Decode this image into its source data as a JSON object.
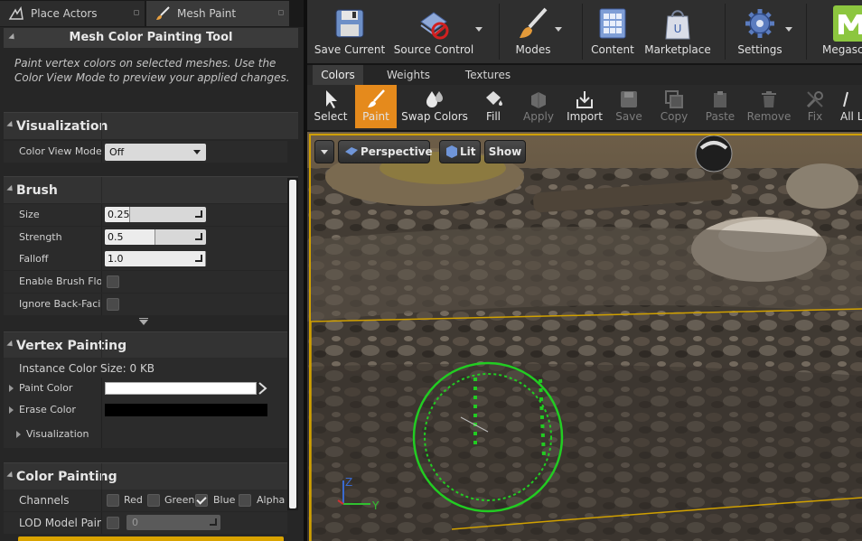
{
  "left_tabs": [
    {
      "label": "Place Actors"
    },
    {
      "label": "Mesh Paint"
    }
  ],
  "tool": {
    "title": "Mesh Color Painting Tool",
    "description": "Paint vertex colors on selected meshes.  Use the Color View Mode to preview your applied changes."
  },
  "visualization": {
    "header": "Visualization",
    "color_view_mode_label": "Color View Mode",
    "color_view_mode_value": "Off"
  },
  "brush": {
    "header": "Brush",
    "size_label": "Size",
    "size_value": "0.25",
    "size_fraction": 0.25,
    "strength_label": "Strength",
    "strength_value": "0.5",
    "strength_fraction": 0.5,
    "falloff_label": "Falloff",
    "falloff_value": "1.0",
    "falloff_fraction": 1.0,
    "enable_flow_label": "Enable Brush Flow",
    "ignore_backfacing_label": "Ignore Back-Facing"
  },
  "vertex_painting": {
    "header": "Vertex Painting",
    "instance_color_size": "Instance Color Size: 0 KB",
    "paint_color_label": "Paint Color",
    "paint_color": "#ffffff",
    "erase_color_label": "Erase Color",
    "erase_color": "#000000",
    "visualization_label": "Visualization"
  },
  "color_painting": {
    "header": "Color Painting",
    "channels_label": "Channels",
    "channels": [
      {
        "label": "Red",
        "checked": false
      },
      {
        "label": "Green",
        "checked": false
      },
      {
        "label": "Blue",
        "checked": true
      },
      {
        "label": "Alpha",
        "checked": false
      }
    ],
    "lod_label": "LOD Model Painting",
    "lod_value": "0"
  },
  "toolbar": {
    "items": [
      {
        "label": "Save Current",
        "icon": "floppy-disk-icon"
      },
      {
        "label": "Source Control",
        "icon": "source-control-icon"
      },
      {
        "label": "Modes",
        "icon": "paint-brush-icon"
      },
      {
        "label": "Content",
        "icon": "content-grid-icon"
      },
      {
        "label": "Marketplace",
        "icon": "shopping-bag-icon"
      },
      {
        "label": "Settings",
        "icon": "gear-icon"
      },
      {
        "label": "Megascans",
        "icon": "megascans-icon"
      }
    ],
    "accent_color": "#8cc63f"
  },
  "mode_tabs": [
    {
      "label": "Colors"
    },
    {
      "label": "Weights"
    },
    {
      "label": "Textures"
    }
  ],
  "paint_tools": [
    {
      "label": "Select",
      "enabled": true
    },
    {
      "label": "Paint",
      "enabled": true,
      "active": true
    },
    {
      "label": "Swap Colors",
      "enabled": true
    },
    {
      "label": "Fill",
      "enabled": true
    },
    {
      "label": "Apply",
      "enabled": false
    },
    {
      "label": "Import",
      "enabled": true
    },
    {
      "label": "Save",
      "enabled": false
    },
    {
      "label": "Copy",
      "enabled": false
    },
    {
      "label": "Paste",
      "enabled": false
    },
    {
      "label": "Remove",
      "enabled": false
    },
    {
      "label": "Fix",
      "enabled": false
    },
    {
      "label": "All LODs",
      "enabled": true
    }
  ],
  "active_color": "#e58a1c",
  "viewport": {
    "perspective_label": "Perspective",
    "lit_label": "Lit",
    "show_label": "Show",
    "brush_color": "#22cc22",
    "selection_color": "#d0a000",
    "gizmo_z": "Z",
    "gizmo_y": "Y"
  }
}
